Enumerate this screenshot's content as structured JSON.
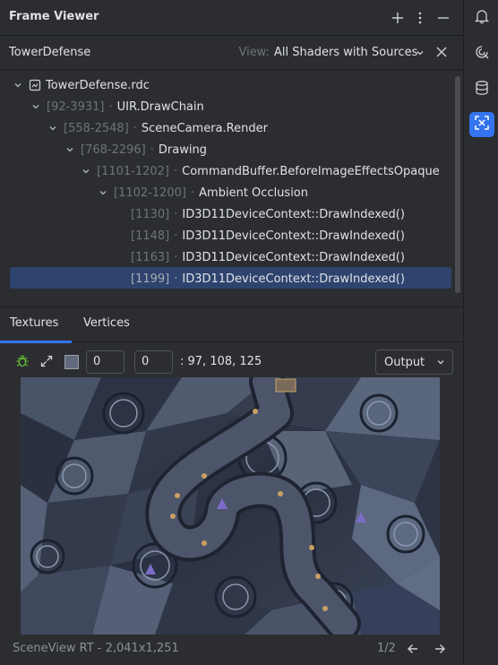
{
  "header": {
    "title": "Frame Viewer"
  },
  "capture_bar": {
    "name": "TowerDefense",
    "view_label": "View:",
    "view_value": "All Shaders with Sources"
  },
  "tree": {
    "root": "TowerDefense.rdc",
    "nodes": [
      {
        "range": "[92-3931]",
        "label": "UIR.DrawChain"
      },
      {
        "range": "[558-2548]",
        "label": "SceneCamera.Render"
      },
      {
        "range": "[768-2296]",
        "label": "Drawing"
      },
      {
        "range": "[1101-1202]",
        "label": "CommandBuffer.BeforeImageEffectsOpaque"
      },
      {
        "range": "[1102-1200]",
        "label": "Ambient Occlusion"
      },
      {
        "range": "[1130]",
        "label": "ID3D11DeviceContext::DrawIndexed()"
      },
      {
        "range": "[1148]",
        "label": "ID3D11DeviceContext::DrawIndexed()"
      },
      {
        "range": "[1163]",
        "label": "ID3D11DeviceContext::DrawIndexed()"
      },
      {
        "range": "[1199]",
        "label": "ID3D11DeviceContext::DrawIndexed()"
      }
    ],
    "separator": "·"
  },
  "tabs": [
    {
      "label": "Textures"
    },
    {
      "label": "Vertices"
    }
  ],
  "texture_toolbar": {
    "x_value": "0",
    "y_value": "0",
    "pixel_rgb": ": 97, 108, 125",
    "output_label": "Output",
    "swatch_color": "#616a7d"
  },
  "footer": {
    "label": "SceneView RT - 2,041x1,251",
    "page": "1/2"
  },
  "colors": {
    "accent": "#3574f0",
    "selection": "#2e436e",
    "debug_green": "#5fb832"
  }
}
